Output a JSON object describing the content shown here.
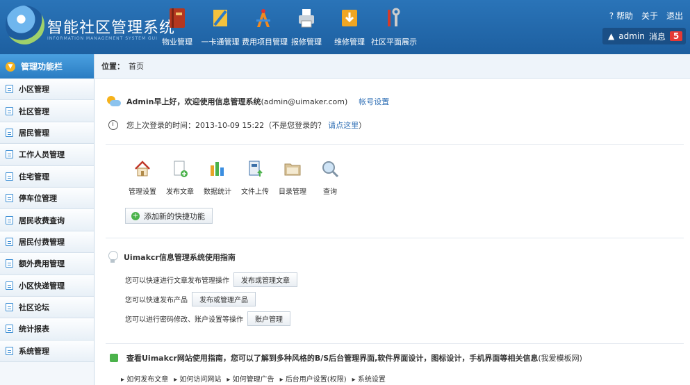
{
  "header": {
    "title": "智能社区管理系统",
    "subtitle": "INFORMATION MANAGEMENT SYSTEM GUI",
    "nav": [
      {
        "label": "物业管理",
        "icon": "book-icon"
      },
      {
        "label": "一卡通管理",
        "icon": "ruler-icon"
      },
      {
        "label": "费用项目管理",
        "icon": "drafting-tools-icon"
      },
      {
        "label": "报修管理",
        "icon": "printer-icon"
      },
      {
        "label": "维修管理",
        "icon": "download-box-icon"
      },
      {
        "label": "社区平面展示",
        "icon": "tools-icon"
      }
    ],
    "help": "帮助",
    "about": "关于",
    "logout": "退出",
    "user": "admin",
    "messages_label": "消息",
    "messages_count": "5"
  },
  "sidebar": {
    "title": "管理功能栏",
    "items": [
      {
        "label": "小区管理"
      },
      {
        "label": "社区管理"
      },
      {
        "label": "居民管理"
      },
      {
        "label": "工作人员管理"
      },
      {
        "label": "住宅管理"
      },
      {
        "label": "停车位管理"
      },
      {
        "label": "居民收费查询"
      },
      {
        "label": "居民付费管理"
      },
      {
        "label": "额外费用管理"
      },
      {
        "label": "小区快递管理"
      },
      {
        "label": "社区论坛"
      },
      {
        "label": "统计报表"
      },
      {
        "label": "系统管理"
      }
    ]
  },
  "breadcrumb": {
    "label": "位置：",
    "current": "首页"
  },
  "welcome": {
    "greeting": "Admin早上好，欢迎使用信息管理系统",
    "email": "(admin@uimaker.com)",
    "account_link": "帐号设置",
    "last_login": "您上次登录的时间：2013-10-09 15:22（不是您登录的？",
    "click_here": "请点这里",
    "close_paren": "）"
  },
  "shortcuts": [
    {
      "label": "管理设置",
      "icon": "home-icon"
    },
    {
      "label": "发布文章",
      "icon": "document-add-icon"
    },
    {
      "label": "数据统计",
      "icon": "bar-chart-icon"
    },
    {
      "label": "文件上传",
      "icon": "file-upload-icon"
    },
    {
      "label": "目录管理",
      "icon": "folder-icon"
    },
    {
      "label": "查询",
      "icon": "magnifier-icon"
    }
  ],
  "add_shortcut": "添加新的快捷功能",
  "guide": {
    "title": "Uimakcr信息管理系统使用指南",
    "rows": [
      {
        "text": "您可以快速进行文章发布管理操作",
        "button": "发布或管理文章"
      },
      {
        "text": "您可以快速发布产品",
        "button": "发布或管理产品"
      },
      {
        "text": "您可以进行密码修改、账户设置等操作",
        "button": "账户管理"
      }
    ]
  },
  "site": {
    "title": "查看Uimakcr网站使用指南，您可以了解到多种风格的B/S后台管理界面,软件界面设计，图标设计，手机界面等相关信息",
    "source": "(我爱模板网)",
    "links": [
      "如何发布文章",
      "如何访问网站",
      "如何管理广告",
      "后台用户设置(权限)",
      "系统设置"
    ]
  },
  "colors": {
    "header": "#1d5fa0",
    "accent": "#2f6fb5",
    "sidebar_head": "#2a7cc2",
    "badge": "#e53935"
  }
}
